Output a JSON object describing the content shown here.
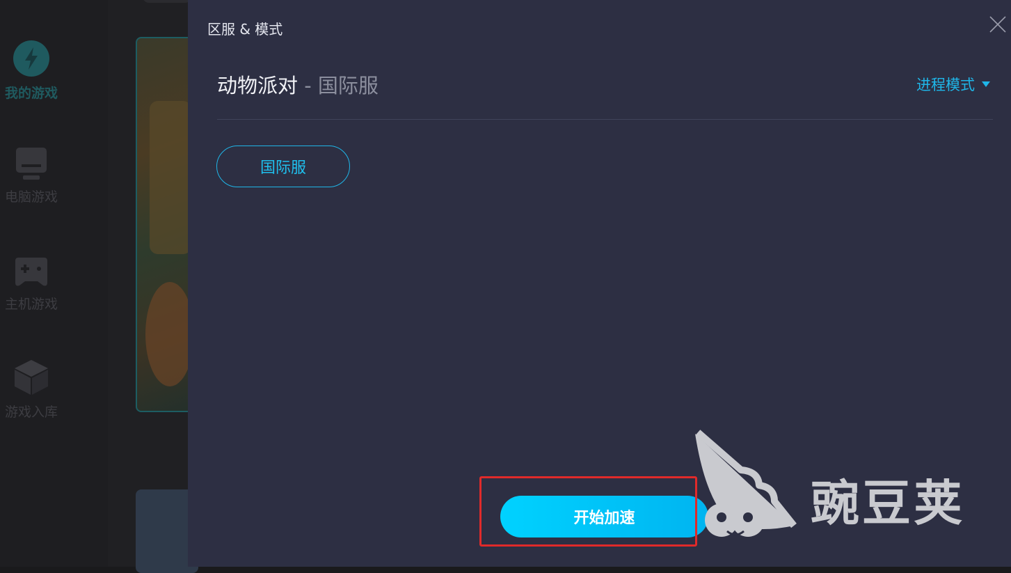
{
  "sidebar": {
    "items": [
      {
        "label": "我的游戏",
        "icon": "lightning-icon",
        "active": true
      },
      {
        "label": "电脑游戏",
        "icon": "monitor-icon",
        "active": false
      },
      {
        "label": "主机游戏",
        "icon": "gamepad-icon",
        "active": false
      },
      {
        "label": "游戏入库",
        "icon": "box-icon",
        "active": false
      }
    ]
  },
  "panel": {
    "title": "区服 & 模式",
    "close_icon": "close-icon",
    "game_name": "动物派对",
    "separator": " - ",
    "selected_server": "国际服",
    "mode_label": "进程模式",
    "mode_icon": "caret-down-icon",
    "server_options": [
      "国际服"
    ],
    "start_button_label": "开始加速"
  },
  "watermark": {
    "text": "豌豆荚"
  },
  "colors": {
    "panel_bg": "#2d2f43",
    "accent": "#1fb6e8",
    "start_gradient_from": "#00d2ff",
    "start_gradient_to": "#00b4f0",
    "highlight": "#e02a2a"
  }
}
